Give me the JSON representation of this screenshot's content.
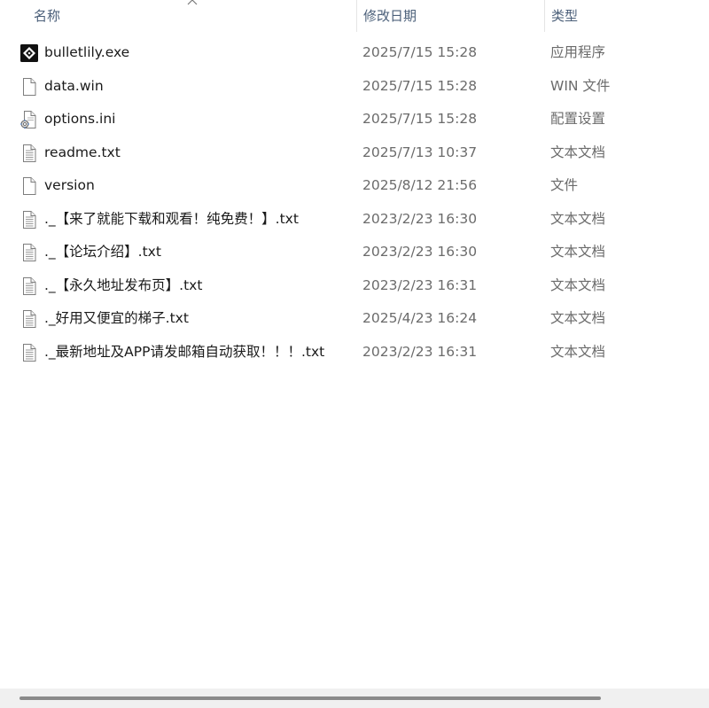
{
  "columns": {
    "name": "名称",
    "date": "修改日期",
    "type": "类型"
  },
  "files": [
    {
      "name": "bulletlily.exe",
      "date": "2025/7/15 15:28",
      "type": "应用程序",
      "icon": "app-icon"
    },
    {
      "name": "data.win",
      "date": "2025/7/15 15:28",
      "type": "WIN 文件",
      "icon": "blank-file-icon"
    },
    {
      "name": "options.ini",
      "date": "2025/7/15 15:28",
      "type": "配置设置",
      "icon": "config-file-icon"
    },
    {
      "name": "readme.txt",
      "date": "2025/7/13 10:37",
      "type": "文本文档",
      "icon": "text-file-icon"
    },
    {
      "name": "version",
      "date": "2025/8/12 21:56",
      "type": "文件",
      "icon": "blank-file-icon"
    },
    {
      "name": "._【来了就能下载和观看！纯免费！】.txt",
      "date": "2023/2/23 16:30",
      "type": "文本文档",
      "icon": "text-file-icon"
    },
    {
      "name": "._【论坛介绍】.txt",
      "date": "2023/2/23 16:30",
      "type": "文本文档",
      "icon": "text-file-icon"
    },
    {
      "name": "._【永久地址发布页】.txt",
      "date": "2023/2/23 16:31",
      "type": "文本文档",
      "icon": "text-file-icon"
    },
    {
      "name": "._好用又便宜的梯子.txt",
      "date": "2025/4/23 16:24",
      "type": "文本文档",
      "icon": "text-file-icon"
    },
    {
      "name": "._最新地址及APP请发邮箱自动获取！！！.txt",
      "date": "2023/2/23 16:31",
      "type": "文本文档",
      "icon": "text-file-icon"
    }
  ],
  "colors": {
    "header_text": "#4c607a",
    "meta_text": "#6b6b6b",
    "name_text": "#1a1a1a",
    "scroll_thumb": "#8a8a8a"
  }
}
